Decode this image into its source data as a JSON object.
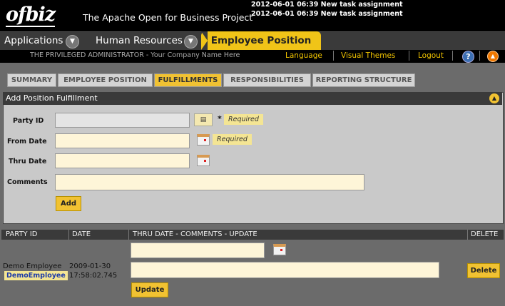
{
  "header": {
    "logo": "ofbiz",
    "tagline": "The Apache Open for Business Project",
    "notifications": [
      "2012-06-01 06:39 New task assignment",
      "2012-06-01 06:39 New task assignment"
    ]
  },
  "appbar": {
    "applications": "Applications",
    "human_resources": "Human Resources",
    "current": "Employee Position",
    "chevron": "chevron-down-icon"
  },
  "userbar": {
    "user": "THE PRIVILEGED ADMINISTRATOR - Your Company Name Here",
    "language": "Language",
    "visual_themes": "Visual Themes",
    "logout": "Logout",
    "help": "?"
  },
  "tabs": [
    "SUMMARY",
    "EMPLOYEE POSITION",
    "FULFILLMENTS",
    "RESPONSIBILITIES",
    "REPORTING STRUCTURE"
  ],
  "form": {
    "title": "Add Position Fulfillment",
    "party_id_label": "Party ID",
    "party_id_value": "",
    "from_date_label": "From Date",
    "from_date_value": "",
    "thru_date_label": "Thru Date",
    "thru_date_value": "",
    "comments_label": "Comments",
    "comments_value": "",
    "required_marker": "*",
    "required": "Required",
    "add_button": "Add"
  },
  "list": {
    "columns": [
      "PARTY ID",
      "DATE",
      "THRU DATE - COMMENTS - UPDATE",
      "DELETE"
    ],
    "rows": [
      {
        "party_name": "Demo Employee",
        "party_link": "DemoEmployee",
        "date_line1": "2009-01-30",
        "date_line2": "17:58:02.745",
        "thru_date": "",
        "comments": "",
        "update_button": "Update",
        "delete_button": "Delete"
      }
    ]
  },
  "colors": {
    "accent": "#f1c232",
    "header": "#000000",
    "panel": "#c9c9c9",
    "input": "#fef5d8"
  }
}
